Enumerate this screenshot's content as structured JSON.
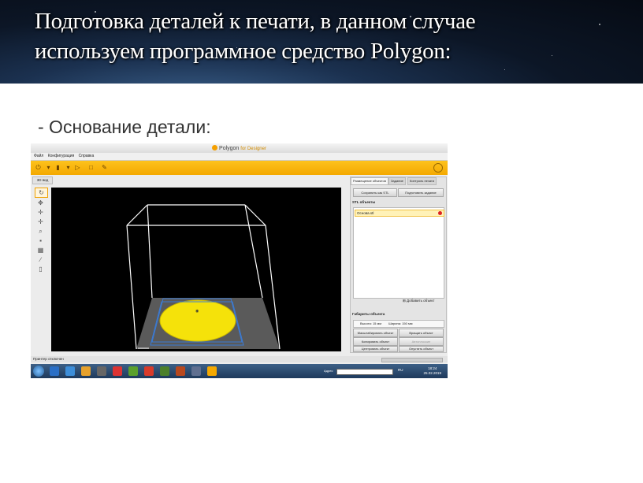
{
  "slide": {
    "title": "Подготовка деталей к печати, в данном случае используем программное средство Polygon:",
    "subtitle": "- Основание детали:"
  },
  "app": {
    "name": "Polygon",
    "name_suffix": "for Designer",
    "menu": [
      "Файл",
      "Конфигурация",
      "Справка"
    ],
    "view_tab": "3D вид",
    "accent_color": "#f5a900"
  },
  "right_panel": {
    "tabs": [
      "Размещение объектов",
      "Задание",
      "Контроль печати"
    ],
    "save_stl_label": "Сохранить как STL",
    "prepare_label": "Подготовить задание",
    "stl_header": "STL объекты",
    "objects": [
      "Основа.stl"
    ],
    "add_object_label": "Добавить объект",
    "dims_header": "Габариты объекта",
    "dims": {
      "height": "Высота: 15 мм",
      "width": "Ширина: 150 мм",
      "depth": "Глубина: 150 мм"
    },
    "actions": [
      "Масштабировать объект",
      "Вращать объект",
      "Копировать объект",
      "Автоплоские",
      "Центровать объект",
      "Опустить объект"
    ]
  },
  "status": {
    "text": "Принтер отключен"
  },
  "taskbar": {
    "address_label": "Адрес",
    "lang": "RU",
    "time": "18:24",
    "date": "25.02.2019"
  }
}
